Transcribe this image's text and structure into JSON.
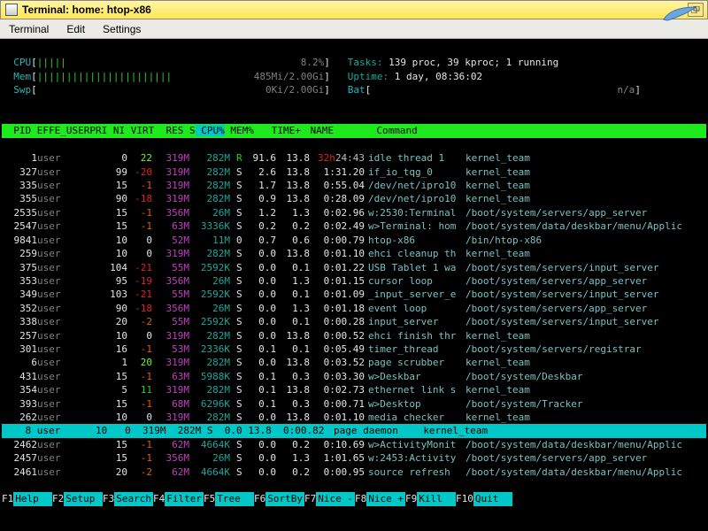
{
  "window": {
    "title": "Terminal: home: htop-x86"
  },
  "menus": [
    "Terminal",
    "Edit",
    "Settings"
  ],
  "meters": {
    "cpu": {
      "label": "CPU",
      "bars": "|||||",
      "pct": "8.2%"
    },
    "mem": {
      "label": "Mem",
      "bars": "|||||||||||||||||||||||",
      "val": "485Mi/2.00Gi"
    },
    "swp": {
      "label": "Swp",
      "bars": "",
      "val": "0Ki/2.00Gi"
    },
    "tasks": {
      "label": "Tasks:",
      "val": "139 proc, 39 kproc; 1 running"
    },
    "uptime": {
      "label": "Uptime:",
      "val": "1 day, 08:36:02"
    },
    "bat": {
      "label": "Bat",
      "val": "n/a"
    }
  },
  "headers": [
    "PID",
    "EFFE_USER",
    "PRI",
    "NI",
    "VIRT",
    "RES",
    "S",
    "CPU%",
    "MEM%",
    "TIME+",
    "NAME",
    "Command"
  ],
  "sort_col": "CPU%",
  "selected_pid": 8,
  "rows": [
    {
      "pid": 1,
      "user": "user",
      "pri": 0,
      "ni": 22,
      "virt": "319M",
      "res": "282M",
      "s": "R",
      "cpu": "91.6",
      "mem": "13.8",
      "time": "32h24:43",
      "time_red": true,
      "name": "idle thread 1",
      "cmd": "kernel_team"
    },
    {
      "pid": 327,
      "user": "user",
      "pri": 99,
      "ni": -20,
      "virt": "319M",
      "res": "282M",
      "s": "S",
      "cpu": "2.6",
      "mem": "13.8",
      "time": "1:31.20",
      "name": "if_io_tqg_0",
      "cmd": "kernel_team"
    },
    {
      "pid": 335,
      "user": "user",
      "pri": 15,
      "ni": -1,
      "virt": "319M",
      "res": "282M",
      "s": "S",
      "cpu": "1.7",
      "mem": "13.8",
      "time": "0:55.04",
      "name": "/dev/net/ipro10",
      "cmd": "kernel_team"
    },
    {
      "pid": 355,
      "user": "user",
      "pri": 90,
      "ni": -18,
      "virt": "319M",
      "res": "282M",
      "s": "S",
      "cpu": "0.9",
      "mem": "13.8",
      "time": "0:28.09",
      "name": "/dev/net/ipro10",
      "cmd": "kernel_team"
    },
    {
      "pid": 2535,
      "user": "user",
      "pri": 15,
      "ni": -1,
      "virt": "356M",
      "res": "26M",
      "s": "S",
      "cpu": "1.2",
      "mem": "1.3",
      "time": "0:02.96",
      "name": "w:2530:Terminal",
      "cmd": "/boot/system/servers/app_server"
    },
    {
      "pid": 2547,
      "user": "user",
      "pri": 15,
      "ni": -1,
      "virt": "63M",
      "res": "3336K",
      "s": "S",
      "cpu": "0.2",
      "mem": "0.2",
      "time": "0:02.49",
      "name": "w>Terminal: hom",
      "cmd": "/boot/system/data/deskbar/menu/Applic"
    },
    {
      "pid": 9841,
      "user": "user",
      "pri": 10,
      "ni": 0,
      "virt": "52M",
      "res": "11M",
      "s": "0",
      "cpu": "0.7",
      "mem": "0.6",
      "time": "0:00.79",
      "name": "htop-x86",
      "cmd": "/bin/htop-x86"
    },
    {
      "pid": 259,
      "user": "user",
      "pri": 10,
      "ni": 0,
      "virt": "319M",
      "res": "282M",
      "s": "S",
      "cpu": "0.0",
      "mem": "13.8",
      "time": "0:01.10",
      "name": "ehci cleanup th",
      "cmd": "kernel_team"
    },
    {
      "pid": 375,
      "user": "user",
      "pri": 104,
      "ni": -21,
      "virt": "55M",
      "res": "2592K",
      "s": "S",
      "cpu": "0.0",
      "mem": "0.1",
      "time": "0:01.22",
      "name": "USB Tablet 1 wa",
      "cmd": "/boot/system/servers/input_server"
    },
    {
      "pid": 353,
      "user": "user",
      "pri": 95,
      "ni": -19,
      "virt": "356M",
      "res": "26M",
      "s": "S",
      "cpu": "0.0",
      "mem": "1.3",
      "time": "0:01.15",
      "name": "cursor loop",
      "cmd": "/boot/system/servers/app_server"
    },
    {
      "pid": 349,
      "user": "user",
      "pri": 103,
      "ni": -21,
      "virt": "55M",
      "res": "2592K",
      "s": "S",
      "cpu": "0.0",
      "mem": "0.1",
      "time": "0:01.09",
      "name": "_input_server_e",
      "cmd": "/boot/system/servers/input_server"
    },
    {
      "pid": 352,
      "user": "user",
      "pri": 90,
      "ni": -18,
      "virt": "356M",
      "res": "26M",
      "s": "S",
      "cpu": "0.0",
      "mem": "1.3",
      "time": "0:01.18",
      "name": "event loop",
      "cmd": "/boot/system/servers/app_server"
    },
    {
      "pid": 338,
      "user": "user",
      "pri": 20,
      "ni": -2,
      "virt": "55M",
      "res": "2592K",
      "s": "S",
      "cpu": "0.0",
      "mem": "0.1",
      "time": "0:00.28",
      "name": "input_server",
      "cmd": "/boot/system/servers/input_server"
    },
    {
      "pid": 257,
      "user": "user",
      "pri": 10,
      "ni": 0,
      "virt": "319M",
      "res": "282M",
      "s": "S",
      "cpu": "0.0",
      "mem": "13.8",
      "time": "0:00.52",
      "name": "ehci finish thr",
      "cmd": "kernel_team"
    },
    {
      "pid": 301,
      "user": "user",
      "pri": 16,
      "ni": -1,
      "virt": "53M",
      "res": "2336K",
      "s": "S",
      "cpu": "0.1",
      "mem": "0.1",
      "time": "0:05.49",
      "name": "timer_thread",
      "cmd": "/boot/system/servers/registrar"
    },
    {
      "pid": 6,
      "user": "user",
      "pri": 1,
      "ni": 20,
      "virt": "319M",
      "res": "282M",
      "s": "S",
      "cpu": "0.0",
      "mem": "13.8",
      "time": "0:03.52",
      "name": "page scrubber",
      "cmd": "kernel_team"
    },
    {
      "pid": 431,
      "user": "user",
      "pri": 15,
      "ni": -1,
      "virt": "63M",
      "res": "5988K",
      "s": "S",
      "cpu": "0.1",
      "mem": "0.3",
      "time": "0:03.30",
      "name": "w>Deskbar",
      "cmd": "/boot/system/Deskbar"
    },
    {
      "pid": 354,
      "user": "user",
      "pri": 5,
      "ni": 11,
      "virt": "319M",
      "res": "282M",
      "s": "S",
      "cpu": "0.1",
      "mem": "13.8",
      "time": "0:02.73",
      "name": "ethernet link s",
      "cmd": "kernel_team"
    },
    {
      "pid": 393,
      "user": "user",
      "pri": 15,
      "ni": -1,
      "virt": "68M",
      "res": "6296K",
      "s": "S",
      "cpu": "0.1",
      "mem": "0.3",
      "time": "0:00.71",
      "name": "w>Desktop",
      "cmd": "/boot/system/Tracker"
    },
    {
      "pid": 262,
      "user": "user",
      "pri": 10,
      "ni": 0,
      "virt": "319M",
      "res": "282M",
      "s": "S",
      "cpu": "0.0",
      "mem": "13.8",
      "time": "0:01.10",
      "name": "media checker",
      "cmd": "kernel_team"
    },
    {
      "pid": 8,
      "user": "user",
      "pri": 10,
      "ni": 0,
      "virt": "319M",
      "res": "282M",
      "s": "S",
      "cpu": "0.0",
      "mem": "13.8",
      "time": "0:00.82",
      "name": "page daemon",
      "cmd": "kernel_team"
    },
    {
      "pid": 2462,
      "user": "user",
      "pri": 15,
      "ni": -1,
      "virt": "62M",
      "res": "4664K",
      "s": "S",
      "cpu": "0.0",
      "mem": "0.2",
      "time": "0:10.69",
      "name": "w>ActivityMonit",
      "cmd": "/boot/system/data/deskbar/menu/Applic"
    },
    {
      "pid": 2457,
      "user": "user",
      "pri": 15,
      "ni": -1,
      "virt": "356M",
      "res": "26M",
      "s": "S",
      "cpu": "0.0",
      "mem": "1.3",
      "time": "1:01.65",
      "name": "w:2453:Activity",
      "cmd": "/boot/system/servers/app_server"
    },
    {
      "pid": 2461,
      "user": "user",
      "pri": 20,
      "ni": -2,
      "virt": "62M",
      "res": "4664K",
      "s": "S",
      "cpu": "0.0",
      "mem": "0.2",
      "time": "0:00.95",
      "name": "source refresh",
      "cmd": "/boot/system/data/deskbar/menu/Applic"
    }
  ],
  "fnkeys": [
    {
      "k": "F1",
      "l": "Help"
    },
    {
      "k": "F2",
      "l": "Setup"
    },
    {
      "k": "F3",
      "l": "Search"
    },
    {
      "k": "F4",
      "l": "Filter"
    },
    {
      "k": "F5",
      "l": "Tree"
    },
    {
      "k": "F6",
      "l": "SortBy"
    },
    {
      "k": "F7",
      "l": "Nice -"
    },
    {
      "k": "F8",
      "l": "Nice +"
    },
    {
      "k": "F9",
      "l": "Kill"
    },
    {
      "k": "F10",
      "l": "Quit"
    }
  ]
}
